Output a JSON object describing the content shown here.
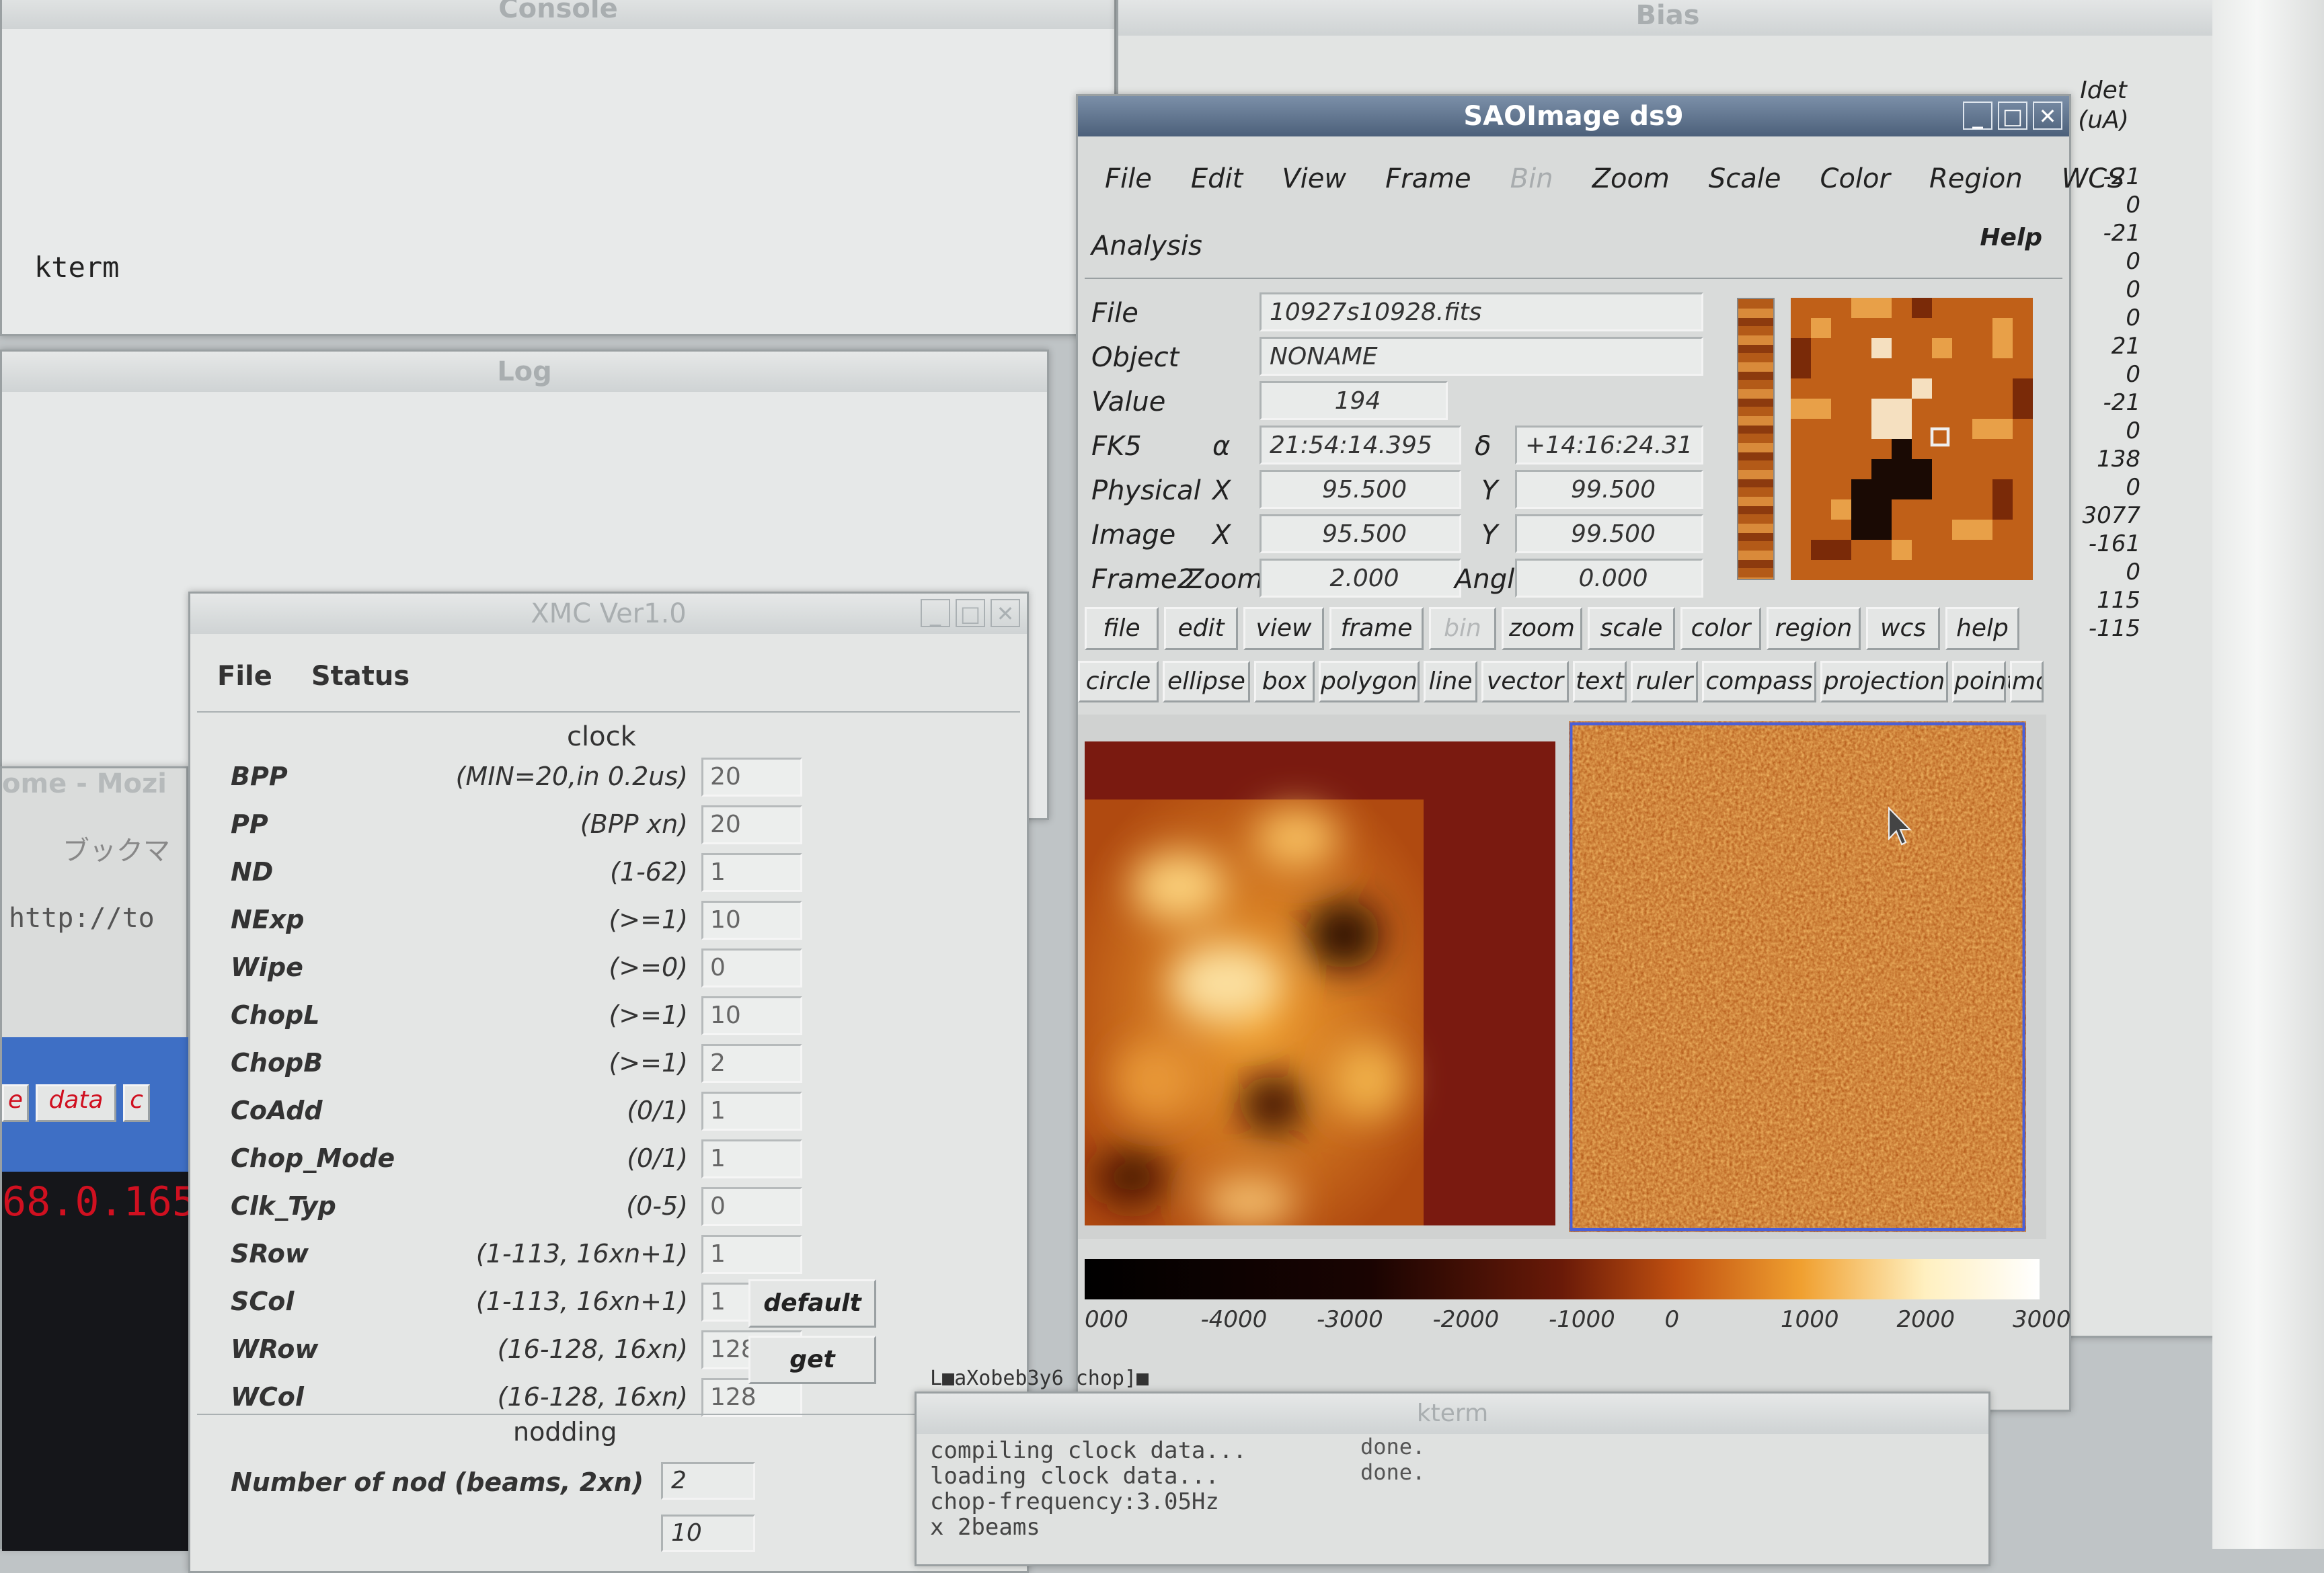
{
  "colors": {
    "desktop": "#bfc4c6",
    "title_active": "#4c607a",
    "selection_frame": "#4a5fd8",
    "link_red": "#d01020"
  },
  "console": {
    "title": "Console",
    "prompt": "kterm"
  },
  "log": {
    "title": "Log"
  },
  "bias": {
    "title": "Bias",
    "idet_header": "Idet",
    "idet_unit": "(uA)",
    "idet_values": [
      "-21",
      "0",
      "-21",
      "0",
      "0",
      "0",
      "21",
      "0",
      "-21",
      "0",
      "138",
      "0",
      "3077",
      "-161",
      "0",
      "115",
      "-115"
    ]
  },
  "mozilla": {
    "title": "ome - Mozi",
    "bookmarks": "ブックマ",
    "url": "http://to",
    "tabs": [
      "e",
      "data",
      "c"
    ],
    "ip": "68.0.165"
  },
  "ds9": {
    "title": "SAOImage ds9",
    "menu": [
      "File",
      "Edit",
      "View",
      "Frame",
      "Bin",
      "Zoom",
      "Scale",
      "Color",
      "Region",
      "WCS"
    ],
    "menu2": "Analysis",
    "help": "Help",
    "info": {
      "file_label": "File",
      "file": "10927s10928.fits",
      "object_label": "Object",
      "object": "NONAME",
      "value_label": "Value",
      "value": "194",
      "fk5_label": "FK5",
      "alpha_sym": "α",
      "alpha": "21:54:14.395",
      "delta_sym": "δ",
      "delta": "+14:16:24.31",
      "physical_label": "Physical",
      "physical_x": "95.500",
      "physical_y": "99.500",
      "image_label": "Image",
      "image_x": "95.500",
      "image_y": "99.500",
      "frame_label": "Frame2",
      "zoom_label": "Zoom",
      "zoom": "2.000",
      "angle_label": "Angle",
      "angle": "0.000",
      "x_label": "X",
      "y_label": "Y"
    },
    "buttons": [
      "file",
      "edit",
      "view",
      "frame",
      "bin",
      "zoom",
      "scale",
      "color",
      "region",
      "wcs",
      "help"
    ],
    "region_buttons": [
      "circle",
      "ellipse",
      "box",
      "polygon",
      "line",
      "vector",
      "text",
      "ruler",
      "compass",
      "projection",
      "point",
      "more"
    ],
    "colorbar_ticks": [
      "000",
      "-4000",
      "-3000",
      "-2000",
      "-1000",
      "0",
      "1000",
      "2000",
      "3000"
    ]
  },
  "xmc": {
    "title": "XMC Ver1.0",
    "menu": [
      "File",
      "Status"
    ],
    "section_clock": "clock",
    "rows": [
      {
        "name": "BPP",
        "hint": "(MIN=20,in 0.2us)",
        "value": "20"
      },
      {
        "name": "PP",
        "hint": "(BPP xn)",
        "value": "20"
      },
      {
        "name": "ND",
        "hint": "(1-62)",
        "value": "1"
      },
      {
        "name": "NExp",
        "hint": "(>=1)",
        "value": "10"
      },
      {
        "name": "Wipe",
        "hint": "(>=0)",
        "value": "0"
      },
      {
        "name": "ChopL",
        "hint": "(>=1)",
        "value": "10"
      },
      {
        "name": "ChopB",
        "hint": "(>=1)",
        "value": "2"
      },
      {
        "name": "CoAdd",
        "hint": "(0/1)",
        "value": "1"
      },
      {
        "name": "Chop_Mode",
        "hint": "(0/1)",
        "value": "1"
      },
      {
        "name": "Clk_Typ",
        "hint": "(0-5)",
        "value": "0"
      },
      {
        "name": "SRow",
        "hint": "(1-113, 16xn+1)",
        "value": "1"
      },
      {
        "name": "SCol",
        "hint": "(1-113, 16xn+1)",
        "value": "1"
      },
      {
        "name": "WRow",
        "hint": "(16-128, 16xn)",
        "value": "128"
      },
      {
        "name": "WCol",
        "hint": "(16-128, 16xn)",
        "value": "128"
      }
    ],
    "default_button": "default",
    "get_button": "get",
    "section_nodding": "nodding",
    "nod_label": "Number of nod (beams, 2xn)",
    "nod_value": "2",
    "nod2_value": "10"
  },
  "kterm2": {
    "title": "kterm",
    "tab_label": "L■aXobeb3y6 chop]■",
    "lines": [
      "compiling clock data...",
      "loading clock data...",
      "chop-frequency:3.05Hz",
      "x 2beams"
    ],
    "done": [
      "done.",
      "done."
    ]
  }
}
